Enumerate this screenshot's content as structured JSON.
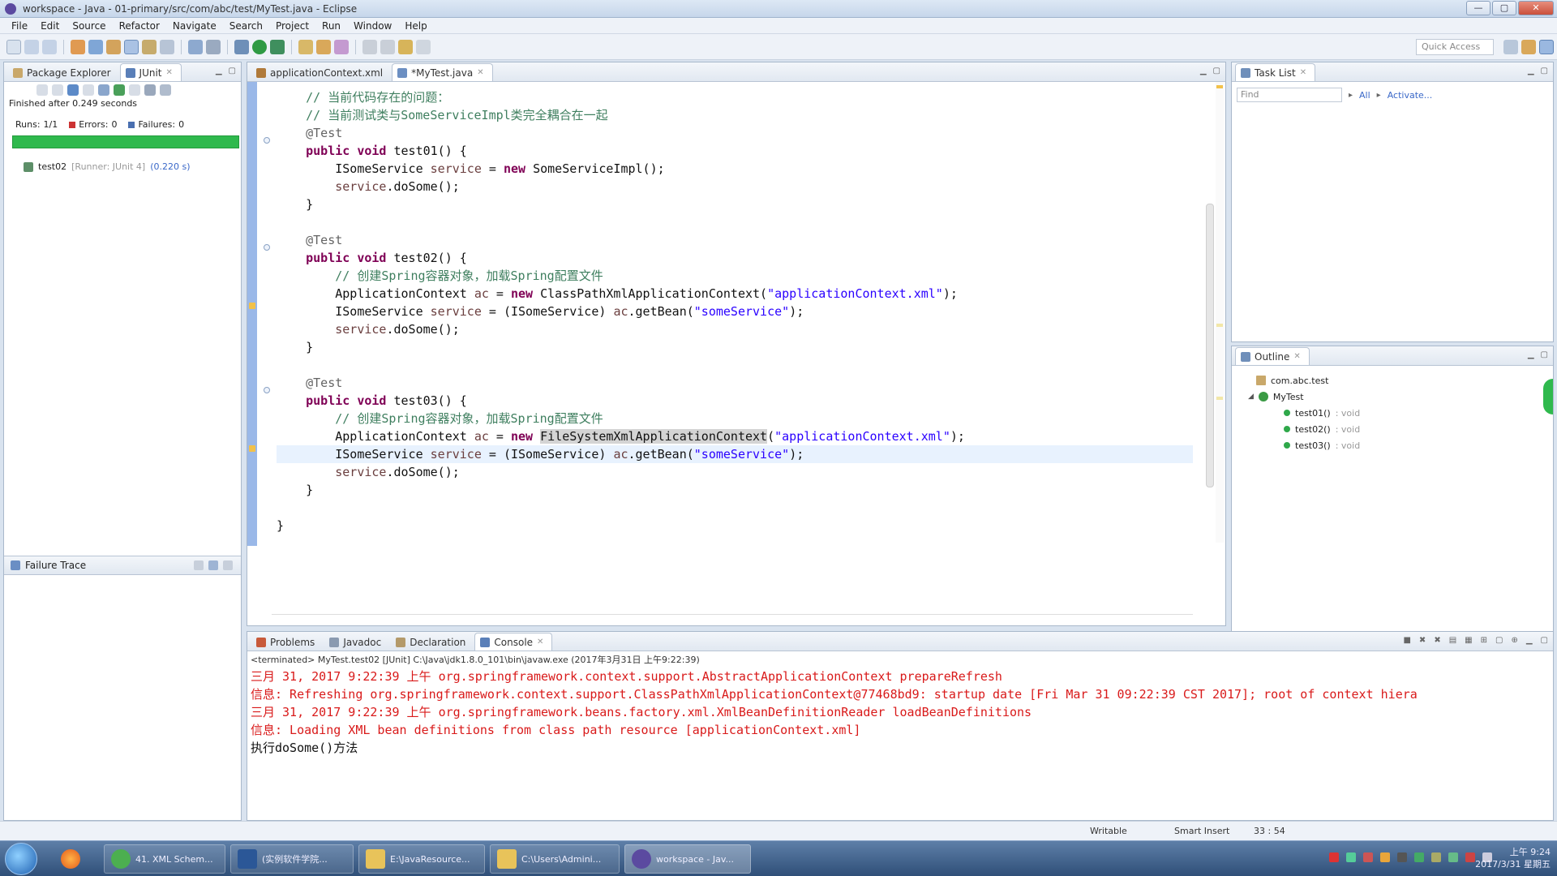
{
  "window": {
    "title": "workspace - Java - 01-primary/src/com/abc/test/MyTest.java - Eclipse",
    "buttons": [
      "—",
      "▢",
      "✕"
    ]
  },
  "menu": [
    "File",
    "Edit",
    "Source",
    "Refactor",
    "Navigate",
    "Search",
    "Project",
    "Run",
    "Window",
    "Help"
  ],
  "toolbar": {
    "quick_access": "Quick Access"
  },
  "left_panel": {
    "tabs": [
      {
        "label": "Package Explorer",
        "active": false
      },
      {
        "label": "JUnit",
        "active": true
      }
    ],
    "status": "Finished after 0.249 seconds",
    "runs_label": "Runs:",
    "runs_value": "1/1",
    "errors_label": "Errors:",
    "errors_value": "0",
    "failures_label": "Failures:",
    "failures_value": "0",
    "progress": 1.0,
    "test_item": {
      "name": "test02",
      "runner": "[Runner: JUnit 4]",
      "time": "(0.220 s)"
    },
    "failure_trace_label": "Failure Trace"
  },
  "editor": {
    "tabs": [
      {
        "label": "applicationContext.xml",
        "active": false
      },
      {
        "label": "*MyTest.java",
        "active": true
      }
    ],
    "lines": [
      {
        "indent": "    ",
        "segments": [
          {
            "t": "cm",
            "v": "// 当前代码存在的问题："
          }
        ]
      },
      {
        "indent": "    ",
        "segments": [
          {
            "t": "cm",
            "v": "// 当前测试类与SomeServiceImpl类完全耦合在一起"
          }
        ]
      },
      {
        "indent": "    ",
        "segments": [
          {
            "t": "an",
            "v": "@Test"
          }
        ]
      },
      {
        "indent": "    ",
        "segments": [
          {
            "t": "kw",
            "v": "public void "
          },
          {
            "t": "pl",
            "v": "test01() {"
          }
        ]
      },
      {
        "indent": "        ",
        "segments": [
          {
            "t": "pl",
            "v": "ISomeService "
          },
          {
            "t": "vr",
            "v": "service"
          },
          {
            "t": "pl",
            "v": " = "
          },
          {
            "t": "kw",
            "v": "new "
          },
          {
            "t": "pl",
            "v": "SomeServiceImpl();"
          }
        ]
      },
      {
        "indent": "        ",
        "segments": [
          {
            "t": "vr",
            "v": "service"
          },
          {
            "t": "pl",
            "v": ".doSome();"
          }
        ]
      },
      {
        "indent": "    ",
        "segments": [
          {
            "t": "pl",
            "v": "}"
          }
        ]
      },
      {
        "indent": "",
        "segments": []
      },
      {
        "indent": "    ",
        "segments": [
          {
            "t": "an",
            "v": "@Test"
          }
        ]
      },
      {
        "indent": "    ",
        "segments": [
          {
            "t": "kw",
            "v": "public void "
          },
          {
            "t": "pl",
            "v": "test02() {"
          }
        ]
      },
      {
        "indent": "        ",
        "segments": [
          {
            "t": "cm",
            "v": "// 创建Spring容器对象，加载Spring配置文件"
          }
        ]
      },
      {
        "indent": "        ",
        "segments": [
          {
            "t": "pl",
            "v": "ApplicationContext "
          },
          {
            "t": "vr",
            "v": "ac"
          },
          {
            "t": "pl",
            "v": " = "
          },
          {
            "t": "kw",
            "v": "new "
          },
          {
            "t": "pl",
            "v": "ClassPathXmlApplicationContext("
          },
          {
            "t": "st",
            "v": "\"applicationContext.xml\""
          },
          {
            "t": "pl",
            "v": ");"
          }
        ]
      },
      {
        "indent": "        ",
        "segments": [
          {
            "t": "pl",
            "v": "ISomeService "
          },
          {
            "t": "vr",
            "v": "service"
          },
          {
            "t": "pl",
            "v": " = (ISomeService) "
          },
          {
            "t": "vr",
            "v": "ac"
          },
          {
            "t": "pl",
            "v": ".getBean("
          },
          {
            "t": "st",
            "v": "\"someService\""
          },
          {
            "t": "pl",
            "v": ");"
          }
        ]
      },
      {
        "indent": "        ",
        "segments": [
          {
            "t": "vr",
            "v": "service"
          },
          {
            "t": "pl",
            "v": ".doSome();"
          }
        ]
      },
      {
        "indent": "    ",
        "segments": [
          {
            "t": "pl",
            "v": "}"
          }
        ]
      },
      {
        "indent": "",
        "segments": []
      },
      {
        "indent": "    ",
        "segments": [
          {
            "t": "an",
            "v": "@Test"
          }
        ]
      },
      {
        "indent": "    ",
        "segments": [
          {
            "t": "kw",
            "v": "public void "
          },
          {
            "t": "pl",
            "v": "test03() {"
          }
        ]
      },
      {
        "indent": "        ",
        "segments": [
          {
            "t": "cm",
            "v": "// 创建Spring容器对象，加载Spring配置文件"
          }
        ]
      },
      {
        "indent": "        ",
        "segments": [
          {
            "t": "pl",
            "v": "ApplicationContext "
          },
          {
            "t": "vr",
            "v": "ac"
          },
          {
            "t": "pl",
            "v": " = "
          },
          {
            "t": "kw",
            "v": "new "
          },
          {
            "t": "occ",
            "v": "FileSystemXmlApplicationContext"
          },
          {
            "t": "pl",
            "v": "("
          },
          {
            "t": "st",
            "v": "\"applicationContext.xml\""
          },
          {
            "t": "pl",
            "v": ");"
          }
        ]
      },
      {
        "indent": "        ",
        "current": true,
        "segments": [
          {
            "t": "pl",
            "v": "ISomeService "
          },
          {
            "t": "vr",
            "v": "service"
          },
          {
            "t": "pl",
            "v": " = (ISomeService) "
          },
          {
            "t": "vr",
            "v": "ac"
          },
          {
            "t": "pl",
            "v": ".getBean("
          },
          {
            "t": "st",
            "v": "\"someService\""
          },
          {
            "t": "pl",
            "v": ");"
          }
        ]
      },
      {
        "indent": "        ",
        "segments": [
          {
            "t": "vr",
            "v": "service"
          },
          {
            "t": "pl",
            "v": ".doSome();"
          }
        ]
      },
      {
        "indent": "    ",
        "segments": [
          {
            "t": "pl",
            "v": "}"
          }
        ]
      },
      {
        "indent": "",
        "segments": []
      },
      {
        "indent": "",
        "segments": [
          {
            "t": "pl",
            "v": "}"
          }
        ]
      }
    ]
  },
  "task_list": {
    "tab": "Task List",
    "find_placeholder": "Find",
    "all_label": "All",
    "activate_label": "Activate..."
  },
  "outline": {
    "tab": "Outline",
    "package": "com.abc.test",
    "class": "MyTest",
    "methods": [
      {
        "name": "test01()",
        "ret": ": void"
      },
      {
        "name": "test02()",
        "ret": ": void"
      },
      {
        "name": "test03()",
        "ret": ": void"
      }
    ]
  },
  "bottom_panel": {
    "tabs": [
      {
        "label": "Problems",
        "active": false
      },
      {
        "label": "Javadoc",
        "active": false
      },
      {
        "label": "Declaration",
        "active": false
      },
      {
        "label": "Console",
        "active": true
      }
    ],
    "header": "<terminated> MyTest.test02 [JUnit] C:\\Java\\jdk1.8.0_101\\bin\\javaw.exe (2017年3月31日 上午9:22:39)",
    "lines": [
      {
        "color": "red",
        "text": "三月 31, 2017 9:22:39 上午 org.springframework.context.support.AbstractApplicationContext prepareRefresh"
      },
      {
        "color": "red",
        "text": "信息: Refreshing org.springframework.context.support.ClassPathXmlApplicationContext@77468bd9: startup date [Fri Mar 31 09:22:39 CST 2017]; root of context hiera"
      },
      {
        "color": "red",
        "text": "三月 31, 2017 9:22:39 上午 org.springframework.beans.factory.xml.XmlBeanDefinitionReader loadBeanDefinitions"
      },
      {
        "color": "red",
        "text": "信息: Loading XML bean definitions from class path resource [applicationContext.xml]"
      },
      {
        "color": "black",
        "text": "执行doSome()方法"
      }
    ]
  },
  "statusbar": {
    "writable": "Writable",
    "insert_mode": "Smart Insert",
    "position": "33 : 54"
  },
  "taskbar": {
    "tasks": [
      {
        "label": "41. XML Schem...",
        "icon": "chrome-icon",
        "color": "#4caf50",
        "active": false
      },
      {
        "label": "(实例软件学院...",
        "icon": "word-icon",
        "color": "#2b5797",
        "active": false
      },
      {
        "label": "E:\\JavaResource...",
        "icon": "folder-icon",
        "color": "#e8c35a",
        "active": false
      },
      {
        "label": "C:\\Users\\Admini...",
        "icon": "folder-icon",
        "color": "#e8c35a",
        "active": false
      },
      {
        "label": "workspace - Jav...",
        "icon": "eclipse-icon",
        "color": "#5b4aa0",
        "active": true
      }
    ],
    "clock_time": "上午 9:24",
    "clock_date": "2017/3/31 星期五"
  },
  "colors": {
    "junit_pass": "#2fb94d",
    "keyword": "#7f0055",
    "comment": "#3f7f5f",
    "string": "#2a00ff",
    "console_error": "#d91a1a"
  }
}
